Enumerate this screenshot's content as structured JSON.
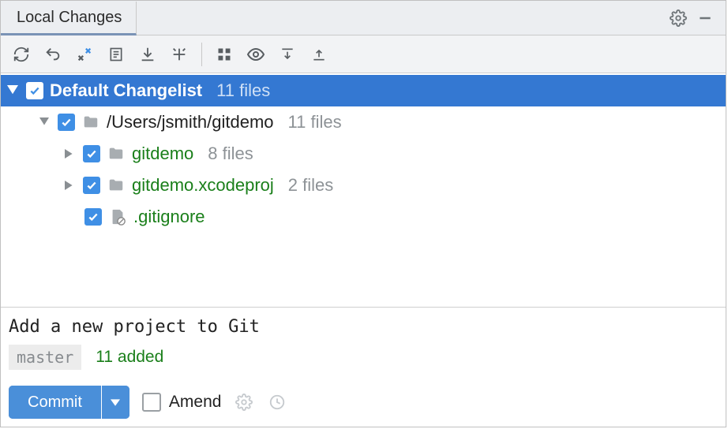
{
  "header": {
    "active_tab": "Local Changes"
  },
  "tree": {
    "root": {
      "label": "Default Changelist",
      "count": "11 files"
    },
    "repo": {
      "path": "/Users/jsmith/gitdemo",
      "count": "11 files"
    },
    "dir1": {
      "name": "gitdemo",
      "count": "8 files"
    },
    "dir2": {
      "name": "gitdemo.xcodeproj",
      "count": "2 files"
    },
    "file1": {
      "name": ".gitignore"
    }
  },
  "commit": {
    "message": "Add a new project to Git",
    "branch": "master",
    "summary": "11 added",
    "button_label": "Commit",
    "amend_label": "Amend"
  }
}
